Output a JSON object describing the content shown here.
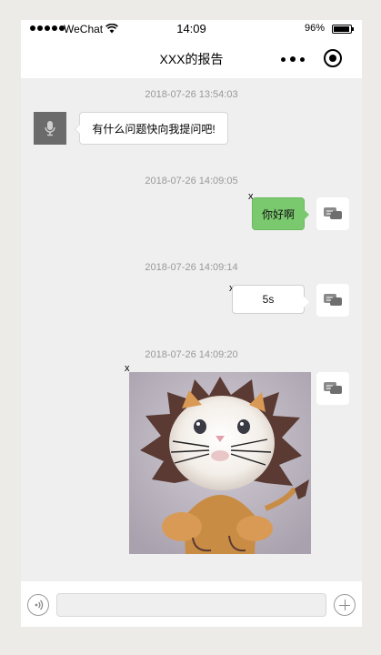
{
  "status_bar": {
    "carrier": "WeChat",
    "time": "14:09",
    "battery": "96%"
  },
  "nav": {
    "title": "XXX的报告"
  },
  "messages": [
    {
      "timestamp": "2018-07-26 13:54:03",
      "side": "left",
      "text": "有什么问题快向我提问吧!"
    },
    {
      "timestamp": "2018-07-26 14:09:05",
      "side": "right",
      "text": "你好啊",
      "delete": "x"
    },
    {
      "timestamp": "2018-07-26 14:09:14",
      "side": "right",
      "text": "5s",
      "delete": "x"
    },
    {
      "timestamp": "2018-07-26 14:09:20",
      "side": "right",
      "image": "cat-in-lion-costume",
      "delete": "x"
    }
  ],
  "input": {
    "value": "",
    "placeholder": ""
  },
  "icons": {
    "left_avatar": "microphone-icon",
    "right_avatar": "chat-bubble-icon",
    "voice": "voice-icon",
    "add": "plus-icon"
  },
  "colors": {
    "sent_bubble": "#7bc96f",
    "background": "#efefef"
  }
}
